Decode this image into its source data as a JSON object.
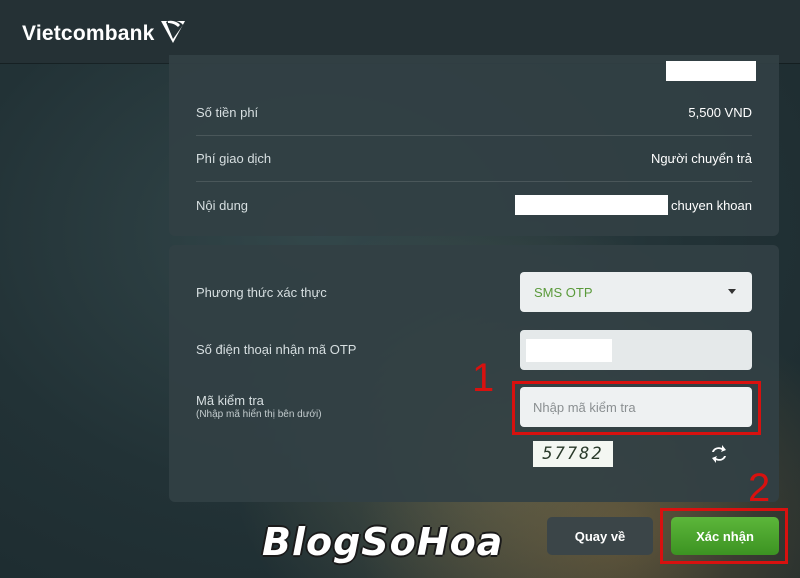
{
  "header": {
    "brand": "Vietcombank"
  },
  "transaction": {
    "fee_amount_label": "Số tiền phí",
    "fee_amount_value": "5,500 VND",
    "fee_payer_label": "Phí giao dịch",
    "fee_payer_value": "Người chuyển trả",
    "content_label": "Nội dung",
    "content_value": "chuyen khoan"
  },
  "auth": {
    "method_label": "Phương thức xác thực",
    "method_value": "SMS OTP",
    "phone_label": "Số điện thoại nhận mã OTP",
    "captcha_label": "Mã kiểm tra",
    "captcha_hint": "(Nhập mã hiển thị bên dưới)",
    "captcha_placeholder": "Nhập mã kiểm tra",
    "captcha_code": "57782"
  },
  "annotations": {
    "step1": "1",
    "step2": "2",
    "color": "#d8110f"
  },
  "actions": {
    "back_label": "Quay về",
    "confirm_label": "Xác nhận",
    "confirm_color": "#4aa52c"
  },
  "watermark": "BlogSoHoa",
  "icons": [
    "vietcombank-logo-icon",
    "chevron-down-icon",
    "refresh-icon"
  ]
}
